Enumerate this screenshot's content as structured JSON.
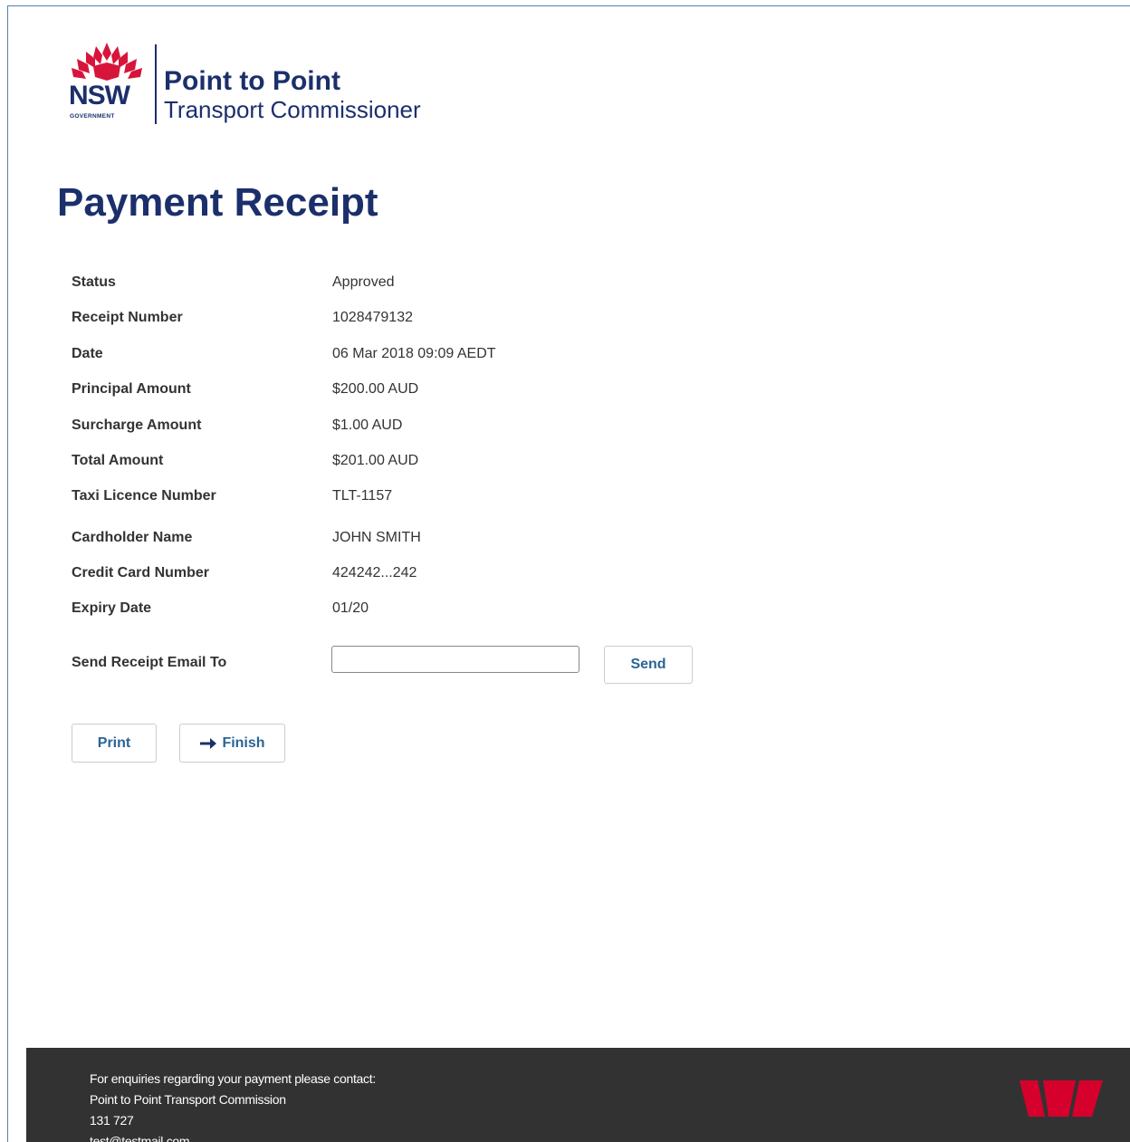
{
  "header": {
    "gov_logo_text": "NSW",
    "gov_sub_text": "GOVERNMENT",
    "org_title": "Point to Point",
    "org_subtitle": "Transport Commissioner"
  },
  "page_title": "Payment Receipt",
  "receipt": [
    {
      "label": "Status",
      "value": "Approved"
    },
    {
      "label": "Receipt Number",
      "value": "1028479132"
    },
    {
      "label": "Date",
      "value": "06 Mar 2018 09:09 AEDT"
    },
    {
      "label": "Principal Amount",
      "value": "$200.00 AUD"
    },
    {
      "label": "Surcharge Amount",
      "value": "$1.00 AUD"
    },
    {
      "label": "Total Amount",
      "value": "$201.00 AUD"
    },
    {
      "label": "Taxi Licence Number",
      "value": "TLT-1157"
    },
    {
      "label": "Cardholder Name",
      "value": "JOHN SMITH"
    },
    {
      "label": "Credit Card Number",
      "value": "424242...242"
    },
    {
      "label": "Expiry Date",
      "value": "01/20"
    }
  ],
  "email": {
    "label": "Send Receipt Email To",
    "value": "",
    "placeholder": "",
    "send_label": "Send"
  },
  "actions": {
    "print_label": "Print",
    "finish_label": "Finish",
    "finish_icon": "arrow-right-icon"
  },
  "footer": {
    "line1": "For enquiries regarding your payment please contact:",
    "line2": "Point to Point Transport Commission",
    "line3": "131 727",
    "line4": "test@testmail.com",
    "bank_logo": "westpac-logo",
    "bank_color": "#d5002b"
  },
  "colors": {
    "brand_navy": "#1b2f6b",
    "waratah_red": "#d7153a",
    "link_blue": "#2a6496",
    "footer_bg": "#333233"
  }
}
